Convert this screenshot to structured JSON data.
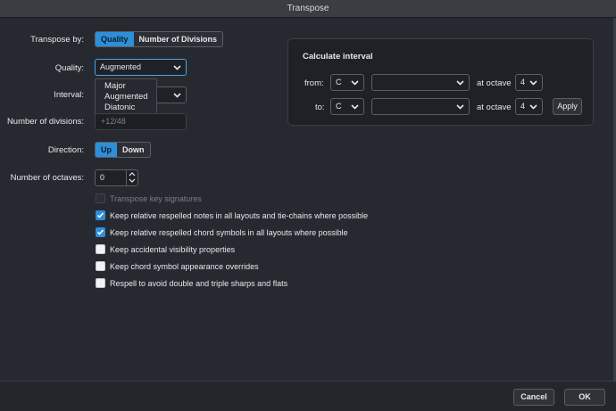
{
  "window": {
    "title": "Transpose"
  },
  "transpose_by": {
    "label": "Transpose by:",
    "options": [
      "Quality",
      "Number of Divisions"
    ],
    "selected": "Quality"
  },
  "quality": {
    "label": "Quality:",
    "value": "Augmented",
    "options": [
      "Major",
      "Augmented",
      "Diatonic"
    ]
  },
  "interval": {
    "label": "Interval:"
  },
  "divisions": {
    "label": "Number of divisions:",
    "placeholder": "+12/48"
  },
  "direction": {
    "label": "Direction:",
    "options": [
      "Up",
      "Down"
    ],
    "selected": "Up"
  },
  "octaves": {
    "label": "Number of octaves:",
    "value": "0"
  },
  "calc": {
    "title": "Calculate interval",
    "from_label": "from:",
    "from_note": "C",
    "from_octave": "4",
    "to_label": "to:",
    "to_note": "C",
    "to_octave": "4",
    "at_octave_label": "at octave",
    "apply_label": "Apply"
  },
  "options": [
    {
      "label": "Transpose key signatures",
      "checked": false,
      "disabled": true
    },
    {
      "label": "Keep relative respelled notes in all layouts and tie-chains where possible",
      "checked": true,
      "disabled": false
    },
    {
      "label": "Keep relative respelled chord symbols in all layouts where possible",
      "checked": true,
      "disabled": false
    },
    {
      "label": "Keep accidental visibility properties",
      "checked": false,
      "disabled": false
    },
    {
      "label": "Keep chord symbol appearance overrides",
      "checked": false,
      "disabled": false
    },
    {
      "label": "Respell to avoid double and triple sharps and flats",
      "checked": false,
      "disabled": false
    }
  ],
  "footer": {
    "cancel_label": "Cancel",
    "ok_label": "OK"
  },
  "colors": {
    "accent": "#2e8fd8",
    "background": "#262a30"
  }
}
